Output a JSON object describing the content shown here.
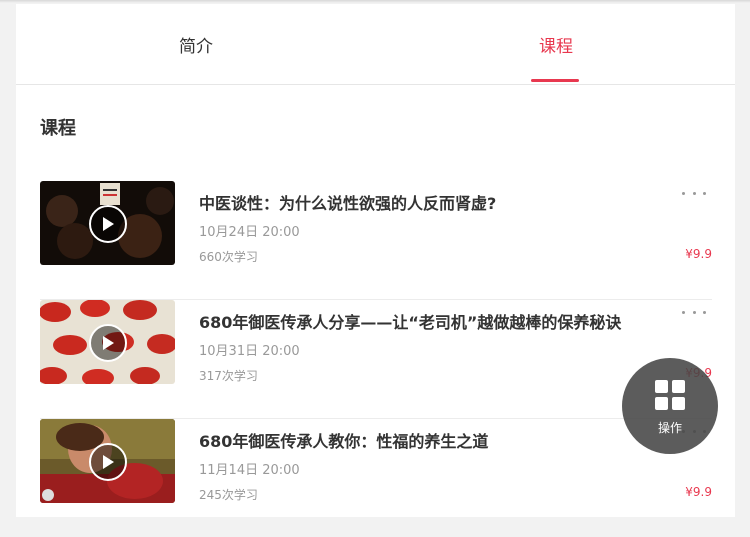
{
  "tabs": [
    {
      "label": "简介",
      "active": false
    },
    {
      "label": "课程",
      "active": true
    }
  ],
  "accent_color": "#e8384f",
  "section_title": "课程",
  "courses": [
    {
      "title": "中医谈性：为什么说性欲强的人反而肾虚?",
      "date": "10月24日 20:00",
      "count": "660次学习",
      "price": "¥9.9"
    },
    {
      "title": "680年御医传承人分享——让“老司机”越做越棒的保养秘诀",
      "date": "10月31日 20:00",
      "count": "317次学习",
      "price": "¥9.9"
    },
    {
      "title": "680年御医传承人教你：性福的养生之道",
      "date": "11月14日 20:00",
      "count": "245次学习",
      "price": "¥9.9"
    }
  ],
  "fab": {
    "label": "操作",
    "icon": "grid-icon"
  },
  "icons": {
    "play": "play-icon",
    "more": "more-dots-icon"
  }
}
